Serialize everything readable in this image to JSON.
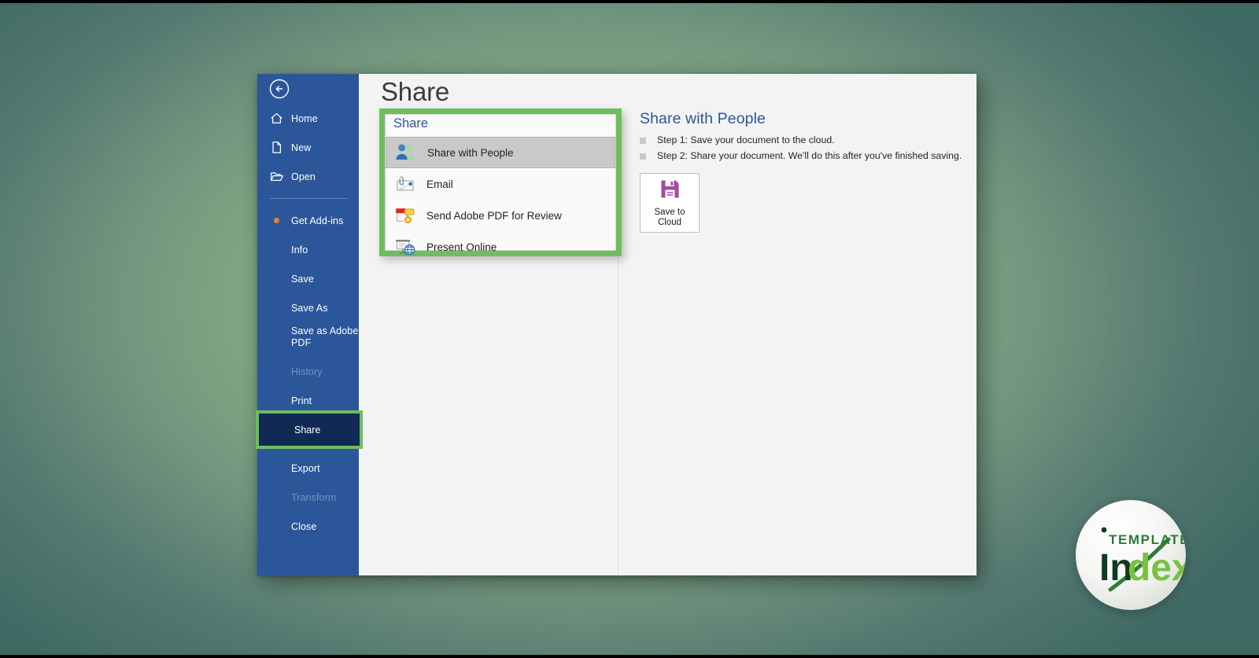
{
  "app": {
    "window_title": "Share",
    "back_icon": "back-arrow-icon",
    "accent_green": "#6cbf5b",
    "accent_blue": "#2b579a",
    "selected_nav_bg": "#112a55",
    "save_icon_purple": "#a349a4"
  },
  "sidebar": {
    "items": [
      {
        "label": "Home",
        "icon": "home-icon",
        "state": "normal"
      },
      {
        "label": "New",
        "icon": "new-file-icon",
        "state": "normal"
      },
      {
        "label": "Open",
        "icon": "open-folder-icon",
        "state": "normal"
      },
      {
        "label": "Get Add-ins",
        "icon": "orange-dot-icon",
        "state": "normal"
      },
      {
        "label": "Info",
        "icon": "",
        "state": "normal"
      },
      {
        "label": "Save",
        "icon": "",
        "state": "normal"
      },
      {
        "label": "Save As",
        "icon": "",
        "state": "normal"
      },
      {
        "label": "Save as Adobe PDF",
        "icon": "",
        "state": "normal"
      },
      {
        "label": "History",
        "icon": "",
        "state": "disabled"
      },
      {
        "label": "Print",
        "icon": "",
        "state": "normal"
      },
      {
        "label": "Share",
        "icon": "",
        "state": "selected"
      },
      {
        "label": "Export",
        "icon": "",
        "state": "normal"
      },
      {
        "label": "Transform",
        "icon": "",
        "state": "disabled"
      },
      {
        "label": "Close",
        "icon": "",
        "state": "normal"
      }
    ]
  },
  "share_panel": {
    "heading": "Share",
    "options": [
      {
        "label": "Share with People",
        "icon": "share-people-icon",
        "selected": true
      },
      {
        "label": "Email",
        "icon": "email-icon",
        "selected": false
      },
      {
        "label": "Send Adobe PDF for Review",
        "icon": "adobe-review-icon",
        "selected": false
      },
      {
        "label": "Present Online",
        "icon": "present-online-icon",
        "selected": false
      }
    ]
  },
  "detail": {
    "title": "Share with People",
    "steps": [
      "Step 1: Save your document to the cloud.",
      "Step 2: Share your document. We'll do this after you've finished saving."
    ],
    "save_button": {
      "icon": "floppy-disk-save-icon",
      "line1": "Save to",
      "line2": "Cloud"
    }
  },
  "watermark": {
    "text_top": "TEMPLATES",
    "text_main": "Index"
  }
}
